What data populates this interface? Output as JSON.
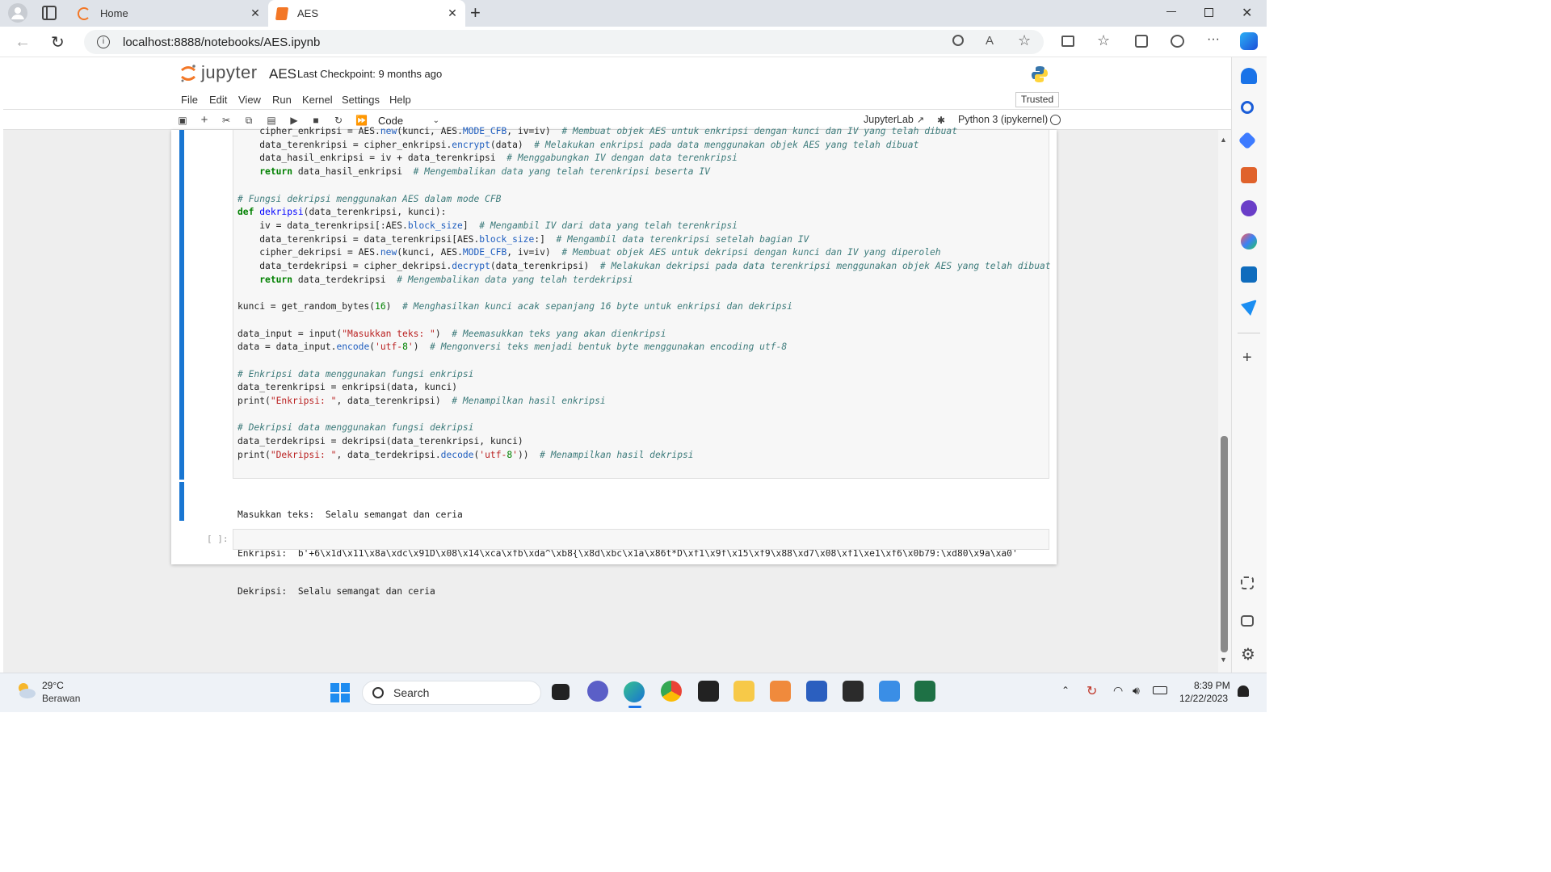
{
  "browser": {
    "tabs": [
      {
        "label": "Home"
      },
      {
        "label": "AES"
      }
    ],
    "url": "localhost:8888/notebooks/AES.ipynb"
  },
  "jupyter": {
    "logo_text": "jupyter",
    "notebook_name": "AES",
    "checkpoint": "Last Checkpoint: 9 months ago",
    "menu": [
      "File",
      "Edit",
      "View",
      "Run",
      "Kernel",
      "Settings",
      "Help"
    ],
    "trusted": "Trusted",
    "cell_type": "Code",
    "jupyterlab_link": "JupyterLab",
    "kernel": "Python 3 (ipykernel)",
    "empty_prompt": "[ ]:"
  },
  "code_lines": [
    "    cipher_enkripsi = AES.new(kunci, AES.MODE_CFB, iv=iv)  # Membuat objek AES untuk enkripsi dengan kunci dan IV yang telah dibuat",
    "    data_terenkripsi = cipher_enkripsi.encrypt(data)  # Melakukan enkripsi pada data menggunakan objek AES yang telah dibuat",
    "    data_hasil_enkripsi = iv + data_terenkripsi  # Menggabungkan IV dengan data terenkripsi",
    "    return data_hasil_enkripsi  # Mengembalikan data yang telah terenkripsi beserta IV",
    "",
    "# Fungsi dekripsi menggunakan AES dalam mode CFB",
    "def dekripsi(data_terenkripsi, kunci):",
    "    iv = data_terenkripsi[:AES.block_size]  # Mengambil IV dari data yang telah terenkripsi",
    "    data_terenkripsi = data_terenkripsi[AES.block_size:]  # Mengambil data terenkripsi setelah bagian IV",
    "    cipher_dekripsi = AES.new(kunci, AES.MODE_CFB, iv=iv)  # Membuat objek AES untuk dekripsi dengan kunci dan IV yang diperoleh",
    "    data_terdekripsi = cipher_dekripsi.decrypt(data_terenkripsi)  # Melakukan dekripsi pada data terenkripsi menggunakan objek AES yang telah dibuat",
    "    return data_terdekripsi  # Mengembalikan data yang telah terdekripsi",
    "",
    "kunci = get_random_bytes(16)  # Menghasilkan kunci acak sepanjang 16 byte untuk enkripsi dan dekripsi",
    "",
    "data_input = input(\"Masukkan teks: \")  # Meemasukkan teks yang akan dienkripsi",
    "data = data_input.encode('utf-8')  # Mengonversi teks menjadi bentuk byte menggunakan encoding utf-8",
    "",
    "# Enkripsi data menggunakan fungsi enkripsi",
    "data_terenkripsi = enkripsi(data, kunci)",
    "print(\"Enkripsi: \", data_terenkripsi)  # Menampilkan hasil enkripsi",
    "",
    "# Dekripsi data menggunakan fungsi dekripsi",
    "data_terdekripsi = dekripsi(data_terenkripsi, kunci)",
    "print(\"Dekripsi: \", data_terdekripsi.decode('utf-8'))  # Menampilkan hasil dekripsi"
  ],
  "output_lines": [
    "Masukkan teks:  Selalu semangat dan ceria",
    "Enkripsi:  b'+6\\x1d\\x11\\x8a\\xdc\\x91D\\x08\\x14\\xca\\xfb\\xda^\\xb8{\\x8d\\xbc\\x1a\\x86t*D\\xf1\\x9f\\x15\\xf9\\x88\\xd7\\x08\\xf1\\xe1\\xf6\\x0b79:\\xd80\\x9a\\xa0'",
    "Dekripsi:  Selalu semangat dan ceria"
  ],
  "taskbar": {
    "weather_temp": "29°C",
    "weather_desc": "Berawan",
    "search_label": "Search",
    "time": "8:39 PM",
    "date": "12/22/2023"
  },
  "colors": {
    "cell_selected": "#1976d2",
    "jupyter_orange": "#f37726"
  }
}
